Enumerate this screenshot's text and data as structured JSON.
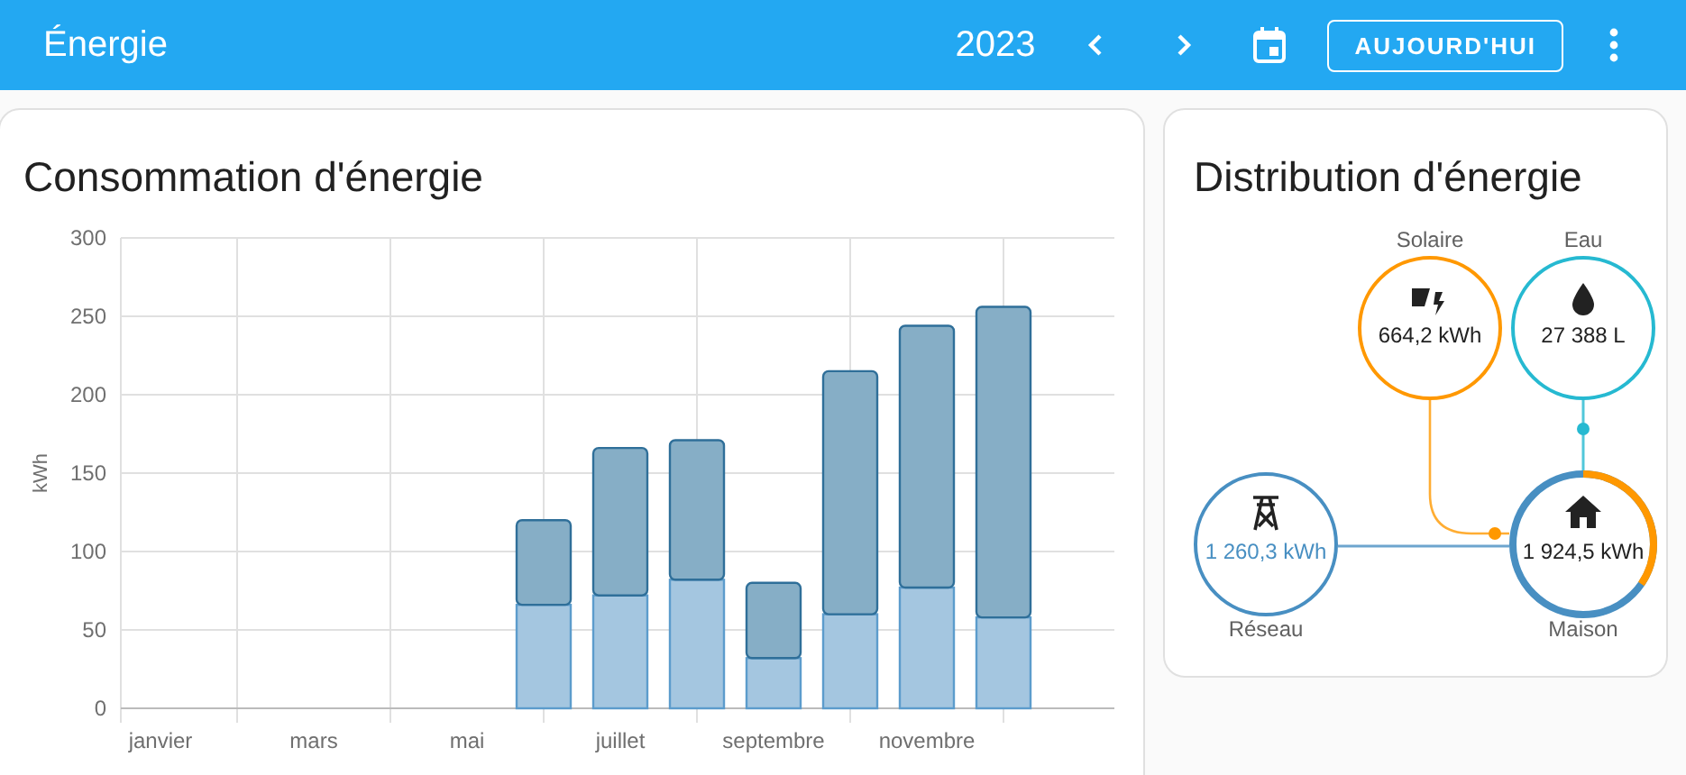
{
  "header": {
    "title": "Énergie",
    "year": "2023",
    "today_button": "AUJOURD'HUI"
  },
  "consumption_card": {
    "title": "Consommation d'énergie",
    "chart_data": {
      "type": "bar",
      "ylabel": "kWh",
      "stacked": true,
      "categories": [
        "janvier",
        null,
        "mars",
        null,
        "mai",
        null,
        "juillet",
        null,
        "septembre",
        null,
        "novembre",
        null
      ],
      "series": [
        {
          "color": "#a4c6e0",
          "values": [
            null,
            null,
            null,
            null,
            null,
            66,
            72,
            82,
            32,
            60,
            77,
            58
          ]
        },
        {
          "color": "#86aec6",
          "values": [
            null,
            null,
            null,
            null,
            null,
            54,
            94,
            89,
            48,
            155,
            167,
            198
          ]
        }
      ],
      "grid": true,
      "ylim": [
        0,
        300
      ],
      "yticks": [
        0,
        50,
        100,
        150,
        200,
        250,
        300
      ]
    }
  },
  "distribution_card": {
    "title": "Distribution d'énergie",
    "nodes": [
      {
        "kind": "solar",
        "label": "Solaire",
        "value": "664,2 kWh",
        "color": "#ff9800"
      },
      {
        "kind": "water",
        "label": "Eau",
        "value": "27 388 L",
        "color": "#26b9d1"
      },
      {
        "kind": "grid",
        "label": "Réseau",
        "value": "1 260,3 kWh",
        "color": "#488fc2"
      },
      {
        "kind": "home",
        "label": "Maison",
        "value": "1 924,5 kWh",
        "color": "#488fc2"
      }
    ]
  }
}
